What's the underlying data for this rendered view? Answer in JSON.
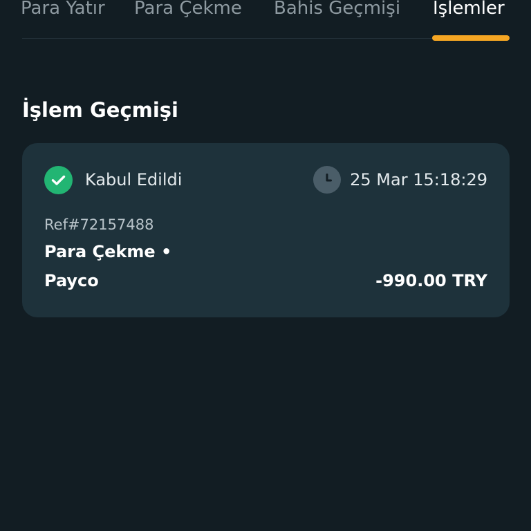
{
  "tabs": [
    {
      "label": "Para Yatır",
      "active": false
    },
    {
      "label": "Para Çekme",
      "active": false
    },
    {
      "label": "Bahis Geçmişi",
      "active": false
    },
    {
      "label": "İşlemler",
      "active": true
    }
  ],
  "section": {
    "title": "İşlem Geçmişi"
  },
  "transaction": {
    "status": "Kabul Edildi",
    "status_icon": "check-circle-icon",
    "datetime": "25 Mar 15:18:29",
    "time_icon": "clock-icon",
    "ref": "Ref#72157488",
    "type": "Para Çekme •",
    "provider": "Payco",
    "amount": "-990.00 TRY"
  },
  "colors": {
    "background": "#121d23",
    "card": "#1e323b",
    "accent": "#f5a623",
    "success": "#22b573"
  }
}
